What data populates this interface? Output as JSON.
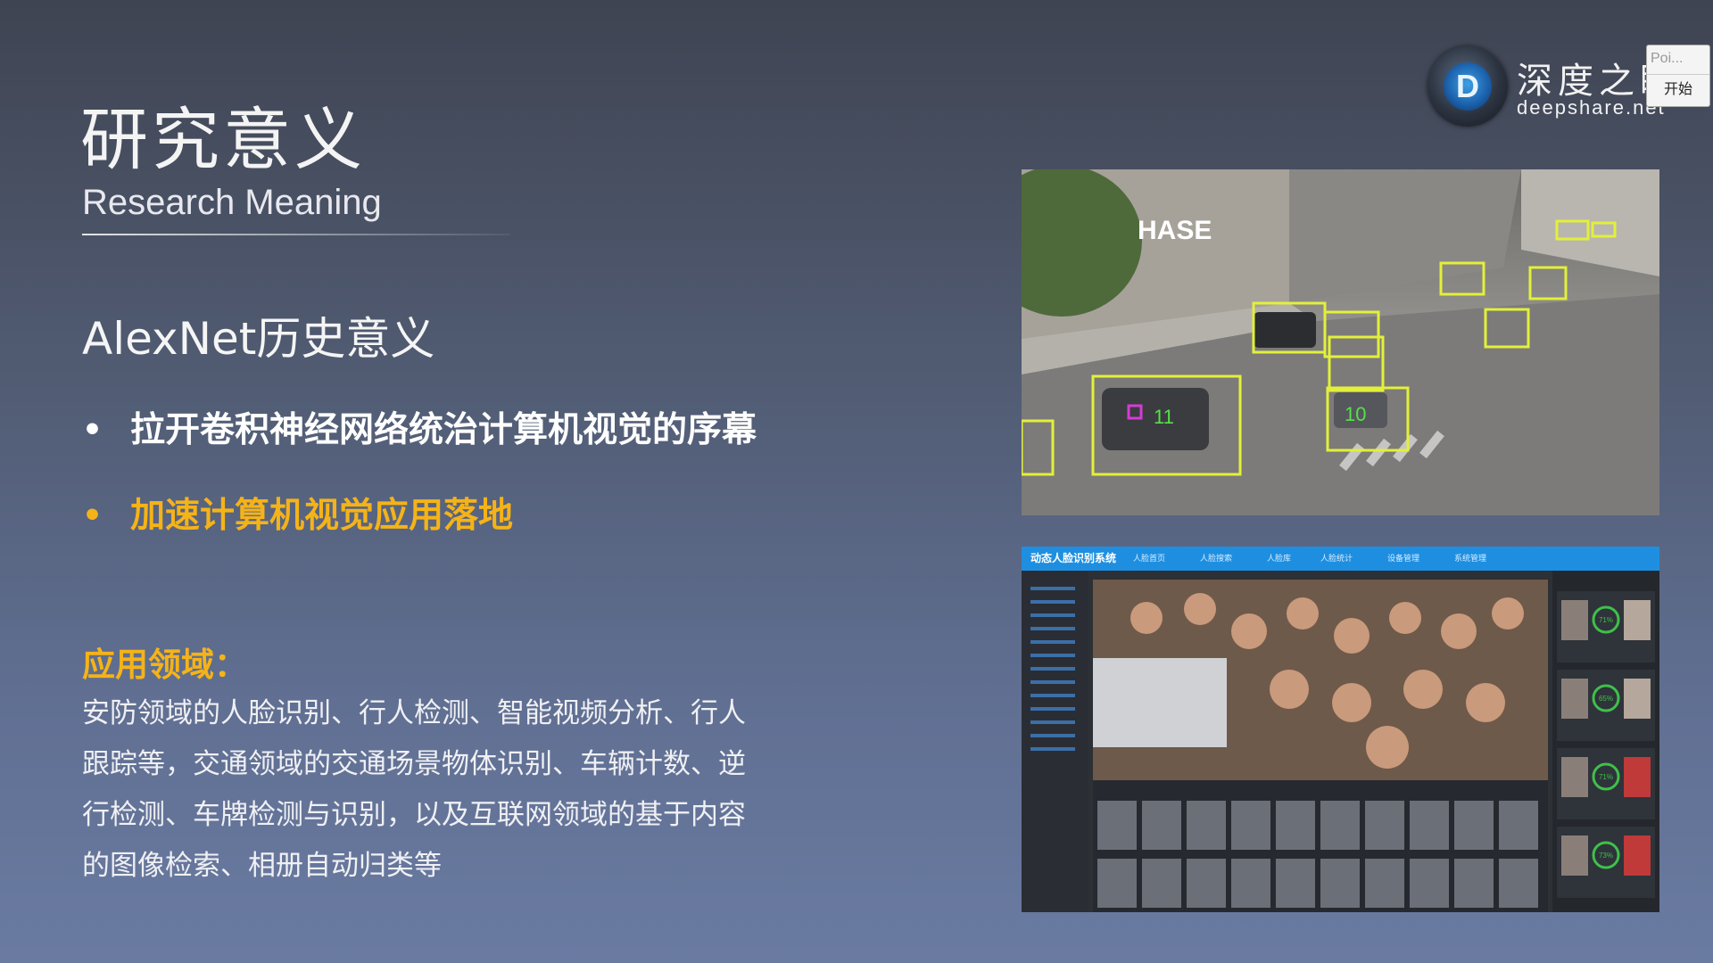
{
  "slide": {
    "title_zh": "研究意义",
    "title_en": "Research Meaning",
    "subtitle": "AlexNet历史意义",
    "bullets": [
      {
        "marker": "•",
        "text": "拉开卷积神经网络统治计算机视觉的序幕",
        "color": "#ffffff"
      },
      {
        "marker": "•",
        "text": "加速计算机视觉应用落地",
        "color": "#f5b318"
      }
    ],
    "application": {
      "heading": "应用领域：",
      "lines": [
        "安防领域的人脸识别、行人检测、智能视频分析、行人",
        "跟踪等，交通领域的交通场景物体识别、车辆计数、逆",
        "行检测、车牌检测与识别，以及互联网领域的基于内容",
        "的图像检索、相册自动归类等"
      ]
    }
  },
  "brand": {
    "logo_letter": "D",
    "name_zh": "深度之眼",
    "name_en": "deepshare.net"
  },
  "widget": {
    "top_text": "Poi...",
    "button_label": "开始"
  },
  "traffic_image": {
    "sign_text": "HASE",
    "box_labels": [
      "11",
      "10"
    ],
    "box_color": "#e2f03a",
    "marker_color": "#d63bd6"
  },
  "face_image": {
    "app_title": "动态人脸识别系统",
    "tabs": [
      "人脸首页",
      "人脸搜索",
      "人脸库",
      "人脸统计",
      "设备管理",
      "系统管理"
    ],
    "match_scores": [
      "71%",
      "65%",
      "71%",
      "73%"
    ],
    "accent": "#1e8fe0"
  },
  "colors": {
    "accent": "#f5b318",
    "background": "#5a6580"
  }
}
